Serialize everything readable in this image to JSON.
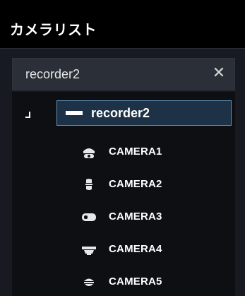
{
  "panel": {
    "title": "カメラリスト"
  },
  "search": {
    "value": "recorder2",
    "clear_icon": "close-icon"
  },
  "tree": {
    "root": {
      "label": "recorder2",
      "icon": "recorder-icon",
      "expanded": true,
      "selected": true
    },
    "cameras": [
      {
        "label": "CAMERA1",
        "icon": "dome-camera-icon"
      },
      {
        "label": "CAMERA2",
        "icon": "bullet-camera-icon"
      },
      {
        "label": "CAMERA3",
        "icon": "box-camera-icon"
      },
      {
        "label": "CAMERA4",
        "icon": "ptz-camera-icon"
      },
      {
        "label": "CAMERA5",
        "icon": "mini-dome-camera-icon"
      }
    ]
  },
  "colors": {
    "selection_fill": "#1d3247",
    "selection_border": "#5f8fb8",
    "tree_background": "#0d0f13",
    "search_background": "#2a2f38"
  }
}
